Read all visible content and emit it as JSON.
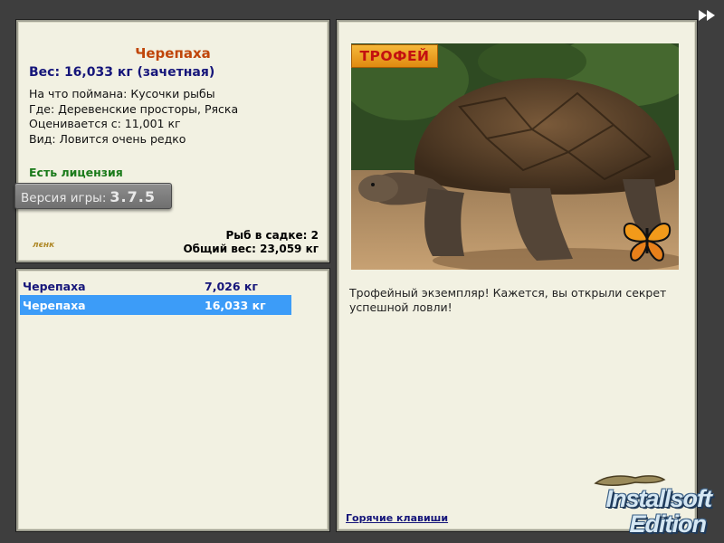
{
  "info": {
    "fish_name": "Черепаха",
    "weight": "Вес: 16,033 кг (зачетная)",
    "details": [
      "На что поймана: Кусочки рыбы",
      "Где: Деревенские просторы, Ряска",
      "Оценивается с: 11,001 кг",
      "Вид: Ловится очень редко"
    ],
    "license": "Есть лицензия",
    "version_label": "Версия игры:",
    "version_value": "3.7.5",
    "logo_text": "лєнк",
    "cage_count": "Рыб в садке: 2",
    "total_weight": "Общий вес: 23,059 кг"
  },
  "catch_list": [
    {
      "name": "Черепаха",
      "weight": "7,026 кг",
      "selected": false
    },
    {
      "name": "Черепаха",
      "weight": "16,033 кг",
      "selected": true
    }
  ],
  "detail": {
    "trophy_badge": "ТРОФЕЙ",
    "trophy_text": "Трофейный экземпляр! Кажется, вы открыли секрет успешной ловли!",
    "hotkeys_link": "Горячие клавиши"
  },
  "brand": {
    "line1": "Installsoft",
    "line2": "Edition"
  },
  "colors": {
    "panel_bg": "#f2f1e2",
    "fish_name": "#c0460a",
    "weight_text": "#16167a",
    "license": "#1a7a1a",
    "selection": "#3c9cf8",
    "trophy_badge": "#f0a020",
    "window_bg": "#3e3e3e"
  },
  "icons": [
    "fast-forward-icon",
    "turtle-photo",
    "butterfly-icon",
    "lizard-icon"
  ]
}
